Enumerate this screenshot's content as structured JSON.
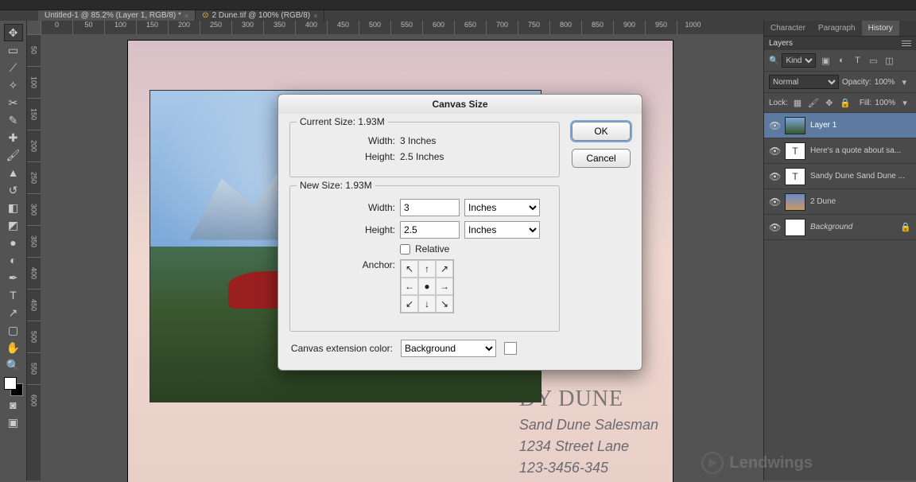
{
  "tabs": [
    {
      "label": "Untitled-1 @ 85.2% (Layer 1, RGB/8) *"
    },
    {
      "label": "2 Dune.tif @ 100% (RGB/8)"
    }
  ],
  "ruler_h": [
    "0",
    "50",
    "100",
    "150",
    "200",
    "250",
    "300",
    "350",
    "400",
    "450",
    "500",
    "550",
    "600",
    "650",
    "700",
    "750",
    "800",
    "850",
    "900",
    "950",
    "1000"
  ],
  "ruler_v": [
    "50",
    "100",
    "150",
    "200",
    "250",
    "300",
    "350",
    "400",
    "450",
    "500",
    "550",
    "600"
  ],
  "dialog": {
    "title": "Canvas Size",
    "current": {
      "label": "Current Size:",
      "size": "1.93M",
      "width_label": "Width:",
      "width": "3 Inches",
      "height_label": "Height:",
      "height": "2.5 Inches"
    },
    "newsize": {
      "label": "New Size:",
      "size": "1.93M",
      "width_label": "Width:",
      "width_value": "3",
      "height_label": "Height:",
      "height_value": "2.5",
      "unit": "Inches",
      "relative": "Relative",
      "anchor": "Anchor:"
    },
    "ext_label": "Canvas extension color:",
    "ext_value": "Background",
    "ok": "OK",
    "cancel": "Cancel"
  },
  "doc_text": {
    "h1": "DY DUNE",
    "l1": "Sand Dune Salesman",
    "l2": "1234 Street Lane",
    "l3": "123-3456-345"
  },
  "panel_tabs": [
    "Character",
    "Paragraph",
    "History"
  ],
  "layers_title": "Layers",
  "kind": "Kind",
  "blend": "Normal",
  "opacity_label": "Opacity:",
  "opacity": "100%",
  "lock_label": "Lock:",
  "fill_label": "Fill:",
  "fill": "100%",
  "layers": [
    {
      "name": "Layer 1",
      "type": "img",
      "sel": true
    },
    {
      "name": "Here's a quote about sa...",
      "type": "T"
    },
    {
      "name": "Sandy Dune Sand Dune ...",
      "type": "T"
    },
    {
      "name": "2 Dune",
      "type": "dune"
    },
    {
      "name": "Background",
      "type": "bg",
      "locked": true
    }
  ],
  "watermark": "Lendwings"
}
